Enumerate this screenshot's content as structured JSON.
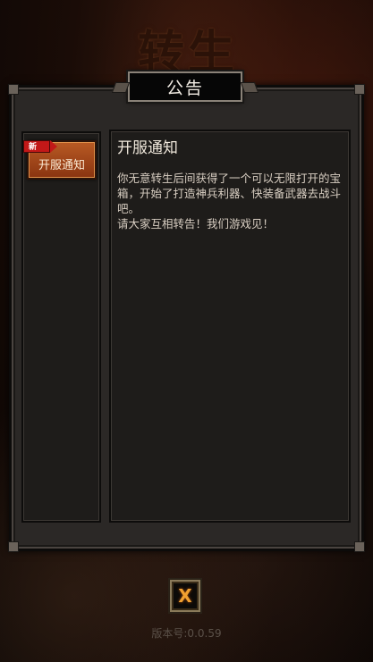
{
  "background": {
    "title_glyphs": "转生"
  },
  "dialog": {
    "title": "公告"
  },
  "notice_list": {
    "items": [
      {
        "label": "开服通知",
        "badge": "新",
        "selected": true
      }
    ]
  },
  "notice_content": {
    "title": "开服通知",
    "body": "你无意转生后间获得了一个可以无限打开的宝箱，开始了打造神兵利器、快装备武器去战斗吧。\n请大家互相转告！我们游戏见！"
  },
  "close_button": {
    "label": "X"
  },
  "version_text": "版本号:0.0.59",
  "colors": {
    "accent_orange": "#f0a030",
    "item_selected": "#b85a24",
    "badge_red": "#c21818"
  }
}
